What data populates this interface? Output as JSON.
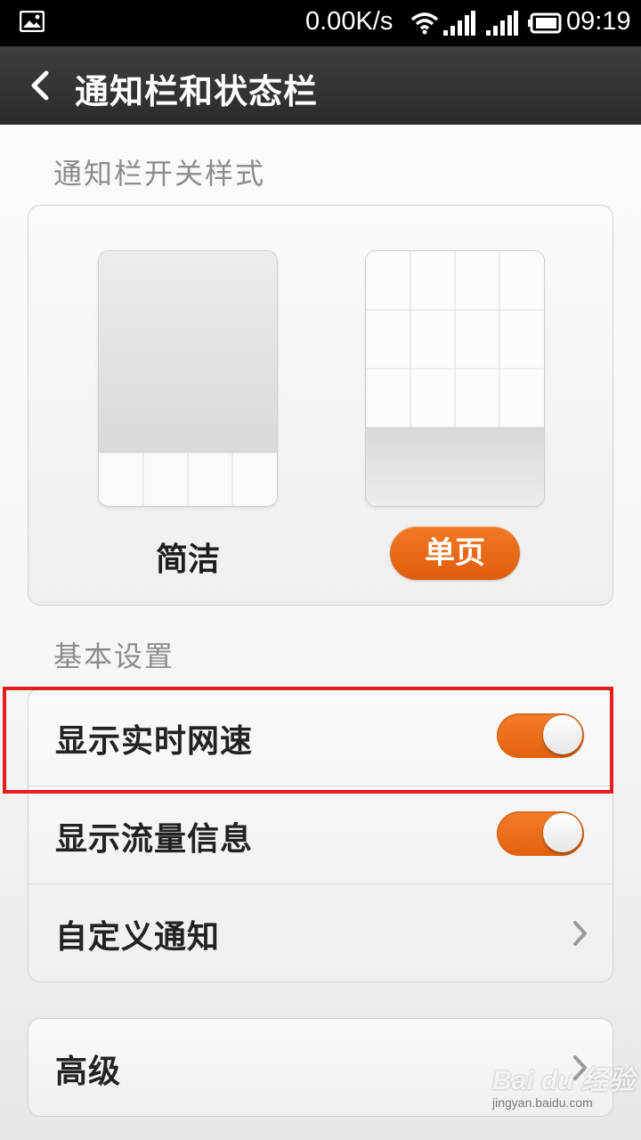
{
  "status_bar": {
    "left_icon": "gallery-notification-icon",
    "speed": "0.00K/s",
    "wifi_icon": "wifi-icon",
    "signal_icon": "signal-icon",
    "battery_icon": "battery-icon",
    "time": "09:19"
  },
  "header": {
    "back_icon": "back-arrow-icon",
    "title": "通知栏和状态栏"
  },
  "toggle_style": {
    "section_title": "通知栏开关样式",
    "options": [
      {
        "label": "简洁",
        "selected": false
      },
      {
        "label": "单页",
        "selected": true
      }
    ]
  },
  "basic_settings": {
    "section_title": "基本设置",
    "items": [
      {
        "label": "显示实时网速",
        "control": "toggle",
        "on": true
      },
      {
        "label": "显示流量信息",
        "control": "toggle",
        "on": true
      },
      {
        "label": "自定义通知",
        "control": "chevron"
      }
    ]
  },
  "advanced": {
    "label": "高级",
    "control": "chevron"
  },
  "watermark": {
    "main": "Bai du 经验",
    "sub": "jingyan.baidu.com"
  },
  "colors": {
    "accent": "#e8661a",
    "highlight": "#e51c1c",
    "title_bar": "#333333"
  }
}
